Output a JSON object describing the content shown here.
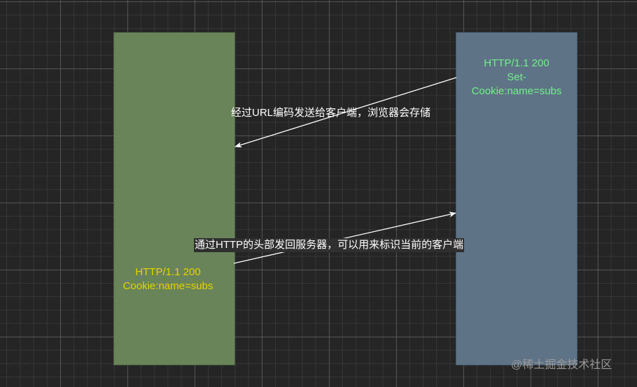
{
  "colors": {
    "background": "#252525",
    "client_box_fill": "#6a8459",
    "server_box_fill": "#5f7386",
    "server_text": "#72f08a",
    "client_text": "#e6d400",
    "arrow": "#ffffff",
    "label_text": "#ffffff",
    "watermark": "#9a9a9a"
  },
  "server_box": {
    "lines": [
      "HTTP/1.1 200",
      "Set-",
      "Cookie:name=subs"
    ]
  },
  "client_box": {
    "lines": [
      "HTTP/1.1 200",
      "Cookie:name=subs"
    ]
  },
  "arrows": {
    "response_label": "经过URL编码发送给客户端，浏览器会存储",
    "request_label": "通过HTTP的头部发回服务器，可以用来标识当前的客户端"
  },
  "watermark": "@稀土掘金技术社区"
}
